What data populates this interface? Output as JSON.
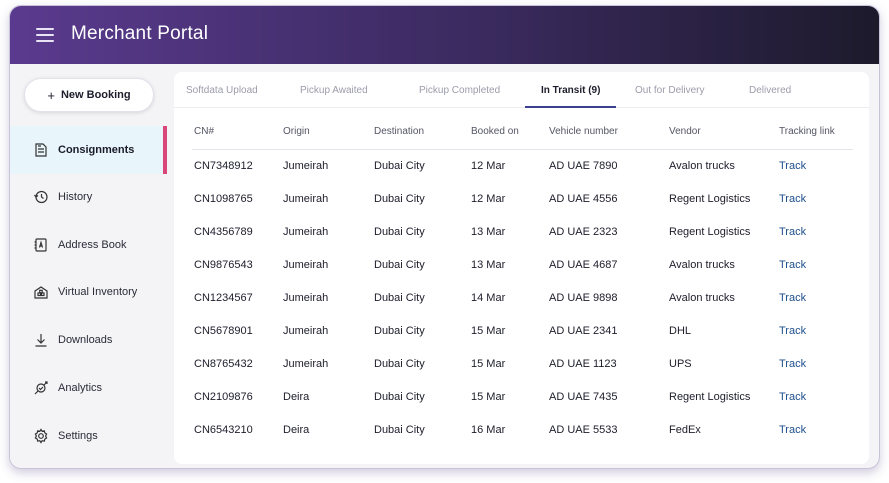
{
  "app": {
    "title": "Merchant Portal"
  },
  "sidebar": {
    "new_booking": {
      "icon": "plus-icon",
      "label": "New Booking"
    },
    "items": [
      {
        "label": "Consignments",
        "icon": "consignments-icon",
        "active": true
      },
      {
        "label": "History",
        "icon": "history-icon",
        "active": false
      },
      {
        "label": "Address Book",
        "icon": "address-book-icon",
        "active": false
      },
      {
        "label": "Virtual Inventory",
        "icon": "inventory-icon",
        "active": false
      },
      {
        "label": "Downloads",
        "icon": "download-icon",
        "active": false
      },
      {
        "label": "Analytics",
        "icon": "analytics-icon",
        "active": false
      },
      {
        "label": "Settings",
        "icon": "gear-icon",
        "active": false
      }
    ]
  },
  "tabs": [
    {
      "label": "Softdata Upload",
      "active": false
    },
    {
      "label": "Pickup Awaited",
      "active": false
    },
    {
      "label": "Pickup Completed",
      "active": false
    },
    {
      "label": "In Transit (9)",
      "active": true
    },
    {
      "label": "Out for Delivery",
      "active": false
    },
    {
      "label": "Delivered",
      "active": false
    }
  ],
  "table": {
    "columns": [
      "CN#",
      "Origin",
      "Destination",
      "Booked on",
      "Vehicle number",
      "Vendor",
      "Tracking link"
    ],
    "rows": [
      [
        "CN7348912",
        "Jumeirah",
        "Dubai City",
        "12 Mar",
        "AD UAE 7890",
        "Avalon trucks",
        "Track"
      ],
      [
        "CN1098765",
        "Jumeirah",
        "Dubai City",
        "12 Mar",
        "AD UAE 4556",
        "Regent Logistics",
        "Track"
      ],
      [
        "CN4356789",
        "Jumeirah",
        "Dubai City",
        "13 Mar",
        "AD UAE 2323",
        "Regent Logistics",
        "Track"
      ],
      [
        "CN9876543",
        "Jumeirah",
        "Dubai City",
        "13 Mar",
        "AD UAE 4687",
        "Avalon trucks",
        "Track"
      ],
      [
        "CN1234567",
        "Jumeirah",
        "Dubai City",
        "14 Mar",
        "AD UAE 9898",
        "Avalon trucks",
        "Track"
      ],
      [
        "CN5678901",
        "Jumeirah",
        "Dubai City",
        "15 Mar",
        "AD UAE 2341",
        "DHL",
        "Track"
      ],
      [
        "CN8765432",
        "Jumeirah",
        "Dubai City",
        "15 Mar",
        "AD UAE 1123",
        "UPS",
        "Track"
      ],
      [
        "CN2109876",
        "Deira",
        "Dubai City",
        "15 Mar",
        "AD UAE 7435",
        "Regent Logistics",
        "Track"
      ],
      [
        "CN6543210",
        "Deira",
        "Dubai City",
        "16 Mar",
        "AD UAE 5533",
        "FedEx",
        "Track"
      ]
    ]
  },
  "colors": {
    "header_start": "#5a3a8e",
    "header_end": "#1d1a2c",
    "active_nav_bg": "#e8f6fb",
    "active_nav_bar": "#d9467a",
    "tab_underline": "#3a3f8f",
    "link": "#1d4f8c"
  }
}
